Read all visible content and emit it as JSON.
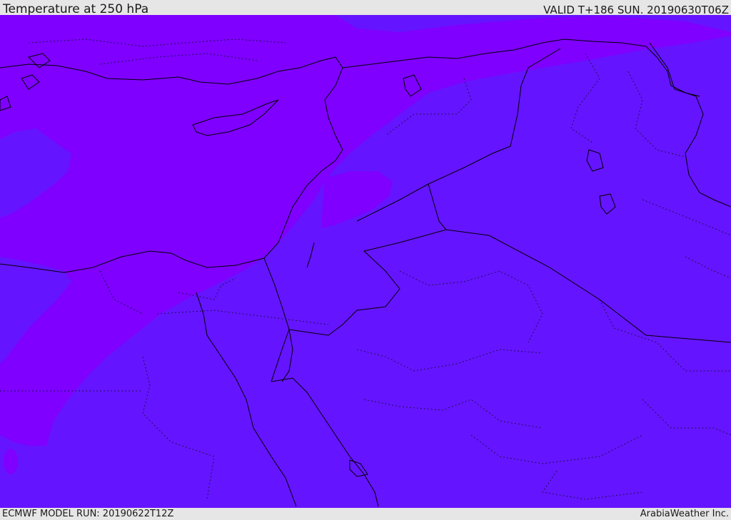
{
  "header": {
    "title": "Temperature at 250 hPa",
    "valid_time": "VALID T+186 SUN. 20190630T06Z"
  },
  "footer": {
    "model_run": "ECMWF MODEL RUN: 20190622T12Z",
    "provider": "ArabiaWeather Inc."
  },
  "map": {
    "colors": {
      "warm_band": "#7f00ff",
      "cool_band": "#6514ff",
      "coastline": "#000000",
      "land_borders": "#1e1050"
    }
  }
}
